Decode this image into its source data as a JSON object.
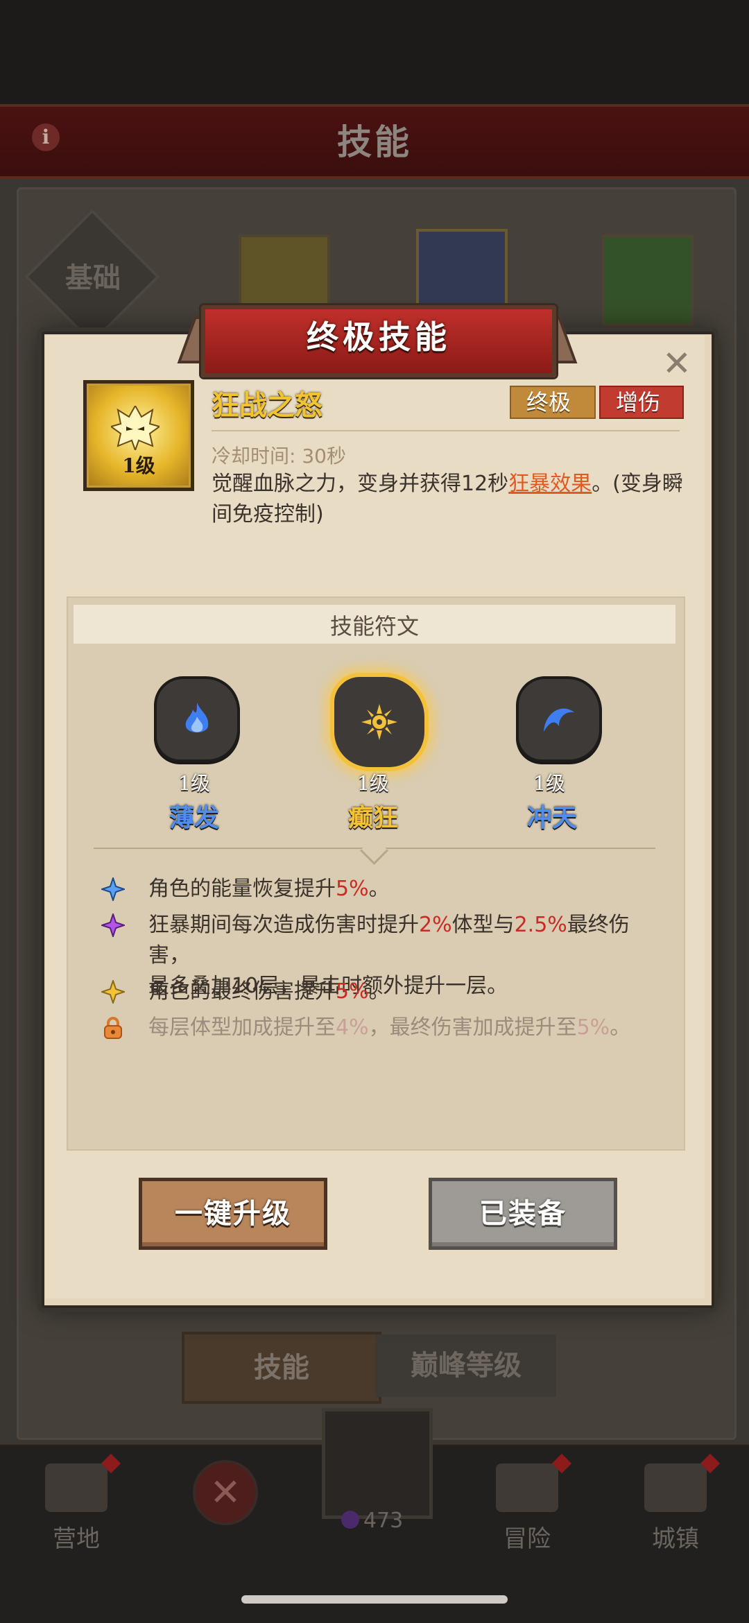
{
  "background": {
    "header_title": "技能",
    "basic_tab_label": "基础",
    "bottom_tabs": [
      "技能",
      "巅峰等级"
    ],
    "nav": {
      "camp": "营地",
      "adventure": "冒险",
      "town": "城镇",
      "currency_count": "473"
    }
  },
  "dialog": {
    "title": "终极技能",
    "skill": {
      "name": "狂战之怒",
      "level": "1级",
      "tags": [
        "终极",
        "增伤"
      ],
      "cooldown": "冷却时间: 30秒",
      "desc_prefix": "觉醒血脉之力，变身并获得12秒",
      "desc_link": "狂暴效果",
      "desc_suffix": "。(变身瞬间免疫控制)"
    },
    "runes": {
      "header": "技能符文",
      "items": [
        {
          "level": "1级",
          "name": "薄发",
          "color": "#4f8ef0"
        },
        {
          "level": "1级",
          "name": "癫狂",
          "color": "#f3c23a",
          "selected": true
        },
        {
          "level": "1级",
          "name": "冲天",
          "color": "#4f8ef0"
        }
      ]
    },
    "effects": [
      {
        "icon": "blue-star-icon",
        "pre": "角色的能量恢复提升",
        "hl": "5%",
        "post": "。"
      },
      {
        "icon": "purple-star-icon",
        "pre": "狂暴期间每次造成伤害时提升",
        "hl": "2%",
        "mid": "体型与",
        "hl2": "2.5%",
        "post": "最终伤害，",
        "line2": "最多叠加10层，暴击时额外提升一层。"
      },
      {
        "icon": "gold-star-icon",
        "pre": "角色的最终伤害提升",
        "hl": "5%",
        "post": "。"
      },
      {
        "icon": "lock-icon",
        "pre": "每层体型加成提升至",
        "hl": "4%",
        "mid": "，最终伤害加成提升至",
        "hl2": "5%",
        "post": "。",
        "locked": true
      }
    ],
    "buttons": {
      "upgrade": "一键升级",
      "equipped": "已装备"
    }
  }
}
